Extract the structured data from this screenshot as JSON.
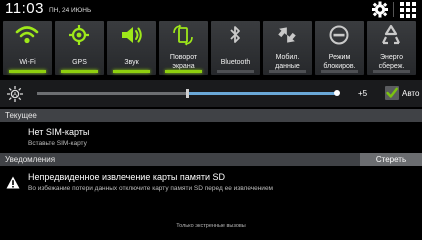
{
  "status_bar": {
    "time": "11:03",
    "date": "ПН, 24 ИЮНЬ"
  },
  "quick_settings": [
    {
      "label": "Wi-Fi",
      "icon": "wifi-icon",
      "active": true
    },
    {
      "label": "GPS",
      "icon": "gps-icon",
      "active": true
    },
    {
      "label": "Звук",
      "icon": "sound-icon",
      "active": true
    },
    {
      "label": "Поворот экрана",
      "icon": "rotate-icon",
      "active": true
    },
    {
      "label": "Bluetooth",
      "icon": "bluetooth-icon",
      "active": false
    },
    {
      "label": "Мобил. данные",
      "icon": "mobile-data-icon",
      "active": false
    },
    {
      "label": "Режим блокиров.",
      "icon": "block-mode-icon",
      "active": false
    },
    {
      "label": "Энерго сбереж.",
      "icon": "power-saving-icon",
      "active": false
    }
  ],
  "brightness": {
    "value_label": "+5",
    "level": 0.5,
    "auto_label": "Авто",
    "auto_checked": true
  },
  "ongoing": {
    "section_title": "Текущее",
    "title": "Нет SIM-карты",
    "subtitle": "Вставьте SIM-карту"
  },
  "notifications": {
    "section_title": "Уведомления",
    "clear_label": "Стереть",
    "title": "Непредвиденное извлечение карты памяти SD",
    "subtitle": "Во избежание потери данных отключите карту памяти SD перед ее извлечением"
  },
  "carrier_label": "Только экстренные вызовы",
  "colors": {
    "accent_on": "#8fcf0f",
    "slider": "#6aa8d8",
    "checkbox": "#7bc20f"
  }
}
